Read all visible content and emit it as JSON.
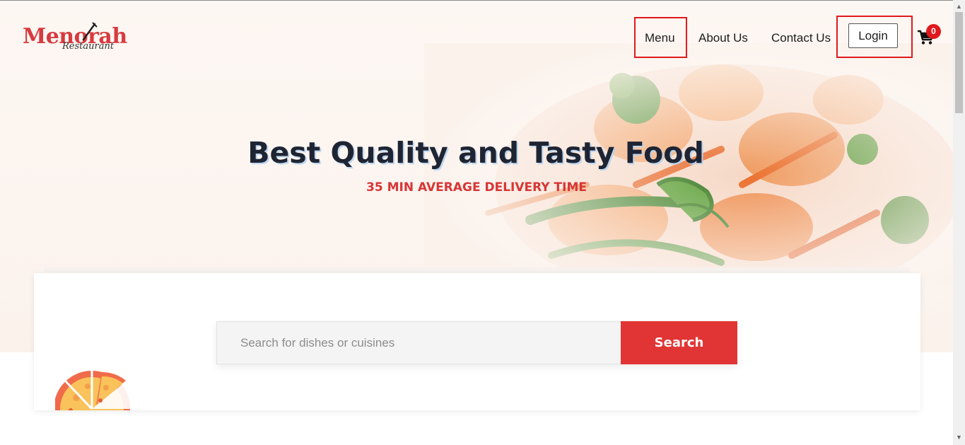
{
  "brand": {
    "name": "Menorah",
    "tagline": "Restaurant"
  },
  "nav": {
    "items": [
      "Menu",
      "About Us",
      "Contact Us"
    ],
    "login_label": "Login",
    "cart_count": "0"
  },
  "hero": {
    "title": "Best Quality and Tasty Food",
    "subtitle": "35 MIN AVERAGE DELIVERY TIME"
  },
  "search": {
    "placeholder": "Search for dishes or cuisines",
    "button_label": "Search"
  },
  "colors": {
    "accent": "#e13535",
    "highlight_border": "#e0191e",
    "title": "#1f2433"
  },
  "icons": [
    "fork-icon",
    "cart-icon",
    "pizza-icon",
    "scroll-up-arrow-icon",
    "scroll-down-arrow-icon"
  ]
}
